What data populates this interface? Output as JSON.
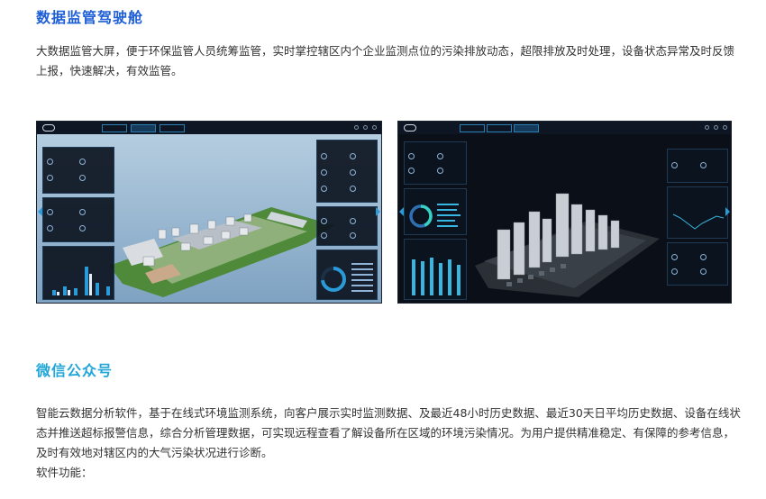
{
  "section1": {
    "title": "数据监管驾驶舱",
    "paragraph": "大数据监管大屏，便于环保监管人员统筹监管，实时掌控辖区内个企业监测点位的污染排放动态，超限排放及时处理，设备状态异常及时反馈上报，快速解决，有效监管。"
  },
  "section2": {
    "title": "微信公众号",
    "paragraph": "智能云数据分析软件，基于在线式环境监测系统，向客户展示实时监测数据、及最近48小时历史数据、最近30天日平均历史数据、设备在线状态并推送超标报警信息，综合分析管理数据，可实现远程查看了解设备所在区域的环境污染情况。为用户提供精准稳定、有保障的参考信息，及时有效地对辖区内的大气污染状况进行诊断。",
    "features_label": "软件功能："
  },
  "colors": {
    "title_blue": "#1e5ed6",
    "title_cyan": "#22a6d8",
    "dashboard_bg": "#0b1220",
    "accent": "#2a9bd8"
  }
}
